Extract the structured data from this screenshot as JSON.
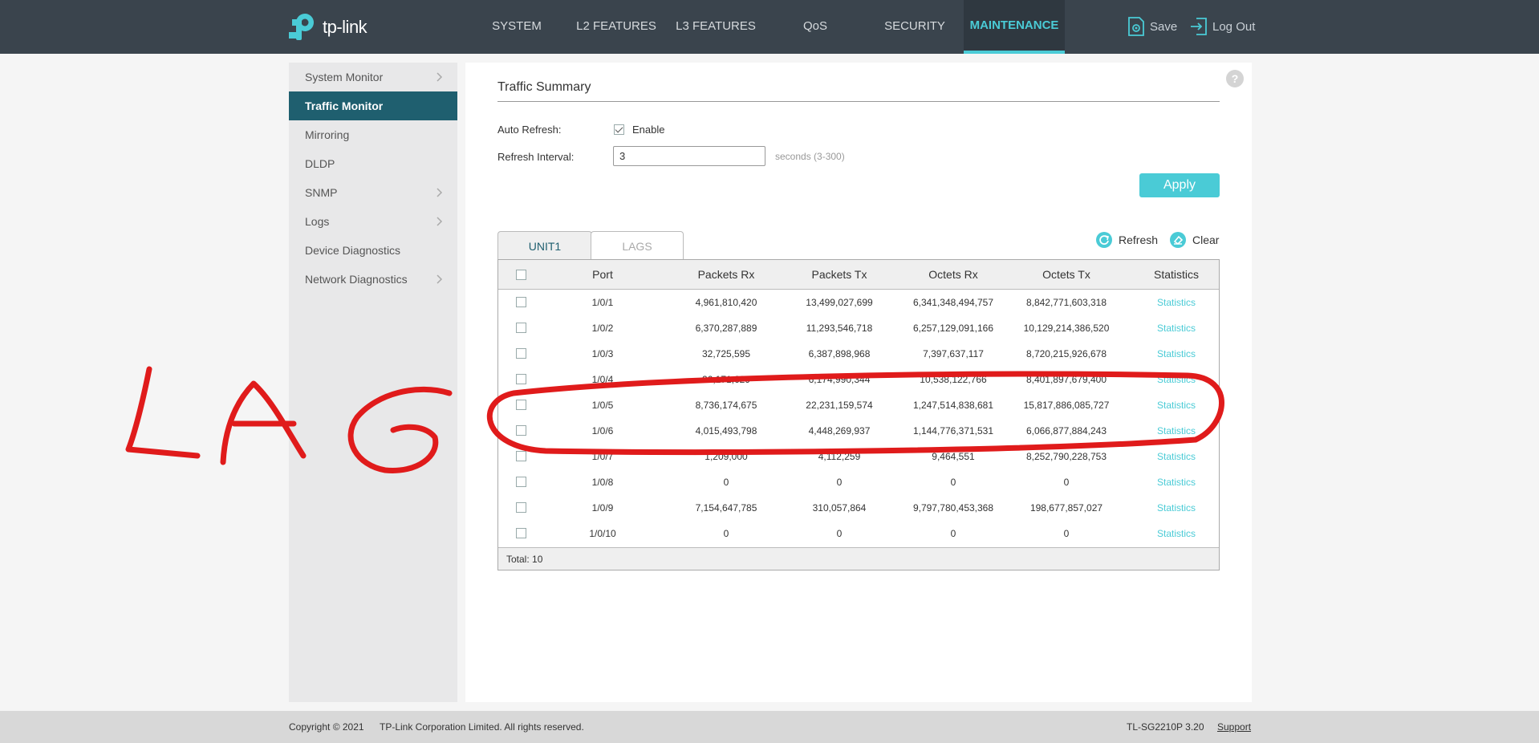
{
  "header": {
    "logo_text": "tp-link",
    "nav": [
      "SYSTEM",
      "L2 FEATURES",
      "L3 FEATURES",
      "QoS",
      "SECURITY",
      "MAINTENANCE"
    ],
    "save_label": "Save",
    "logout_label": "Log Out"
  },
  "sidebar": {
    "items": [
      {
        "label": "System Monitor"
      },
      {
        "label": "Traffic Monitor"
      },
      {
        "label": "Mirroring"
      },
      {
        "label": "DLDP"
      },
      {
        "label": "SNMP"
      },
      {
        "label": "Logs"
      },
      {
        "label": "Device Diagnostics"
      },
      {
        "label": "Network Diagnostics"
      }
    ]
  },
  "main": {
    "title": "Traffic Summary",
    "auto_refresh_label": "Auto Refresh:",
    "enable_label": "Enable",
    "interval_label": "Refresh Interval:",
    "interval_value": "3",
    "interval_hint": "seconds (3-300)",
    "apply_label": "Apply",
    "tabs": [
      "UNIT1",
      "LAGS"
    ],
    "refresh_label": "Refresh",
    "clear_label": "Clear"
  },
  "table": {
    "headers": [
      "Port",
      "Packets Rx",
      "Packets Tx",
      "Octets Rx",
      "Octets Tx",
      "Statistics"
    ],
    "rows": [
      {
        "port": "1/0/1",
        "prx": "4,961,810,420",
        "ptx": "13,499,027,699",
        "orx": "6,341,348,494,757",
        "otx": "8,842,771,603,318",
        "stat": "Statistics"
      },
      {
        "port": "1/0/2",
        "prx": "6,370,287,889",
        "ptx": "11,293,546,718",
        "orx": "6,257,129,091,166",
        "otx": "10,129,214,386,520",
        "stat": "Statistics"
      },
      {
        "port": "1/0/3",
        "prx": "32,725,595",
        "ptx": "6,387,898,968",
        "orx": "7,397,637,117",
        "otx": "8,720,215,926,678",
        "stat": "Statistics"
      },
      {
        "port": "1/0/4",
        "prx": "26,171,629",
        "ptx": "6,174,990,344",
        "orx": "10,538,122,766",
        "otx": "8,401,897,679,400",
        "stat": "Statistics"
      },
      {
        "port": "1/0/5",
        "prx": "8,736,174,675",
        "ptx": "22,231,159,574",
        "orx": "1,247,514,838,681",
        "otx": "15,817,886,085,727",
        "stat": "Statistics"
      },
      {
        "port": "1/0/6",
        "prx": "4,015,493,798",
        "ptx": "4,448,269,937",
        "orx": "1,144,776,371,531",
        "otx": "6,066,877,884,243",
        "stat": "Statistics"
      },
      {
        "port": "1/0/7",
        "prx": "1,209,000",
        "ptx": "4,112,259",
        "orx": "9,464,551",
        "otx": "8,252,790,228,753",
        "stat": "Statistics"
      },
      {
        "port": "1/0/8",
        "prx": "0",
        "ptx": "0",
        "orx": "0",
        "otx": "0",
        "stat": "Statistics"
      },
      {
        "port": "1/0/9",
        "prx": "7,154,647,785",
        "ptx": "310,057,864",
        "orx": "9,797,780,453,368",
        "otx": "198,677,857,027",
        "stat": "Statistics"
      },
      {
        "port": "1/0/10",
        "prx": "0",
        "ptx": "0",
        "orx": "0",
        "otx": "0",
        "stat": "Statistics"
      }
    ],
    "total": "Total: 10"
  },
  "footer": {
    "copyright": "Copyright © 2021",
    "company": "TP-Link Corporation Limited. All rights reserved.",
    "model": "TL-SG2210P 3.20",
    "support": "Support"
  },
  "annotation": {
    "text": "LAG",
    "color": "#e01b1b"
  },
  "colors": {
    "accent": "#4acbd6",
    "header_bg": "#3a444d",
    "sidebar_active": "#1f5f6f"
  }
}
